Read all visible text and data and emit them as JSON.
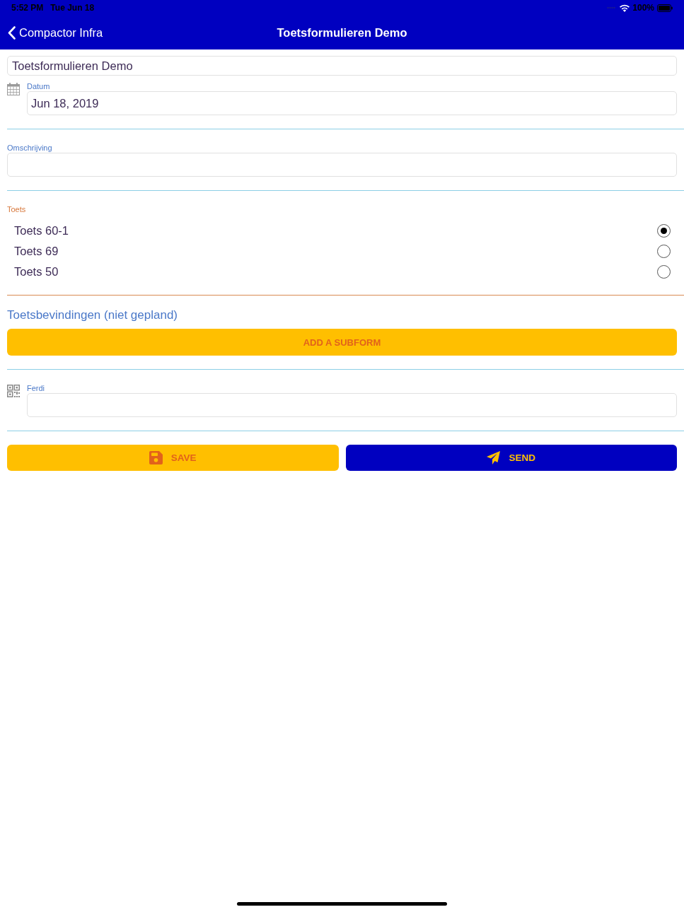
{
  "status_bar": {
    "time": "5:52 PM",
    "date": "Tue Jun 18",
    "battery": "100%"
  },
  "nav_bar": {
    "back_label": "Compactor Infra",
    "title": "Toetsformulieren Demo"
  },
  "title_field": {
    "value": "Toetsformulieren Demo"
  },
  "sections": [
    {
      "kind": "date",
      "label": "Datum",
      "value": "Jun 18, 2019"
    },
    {
      "kind": "text",
      "label": "Omschrijving"
    },
    {
      "kind": "radio",
      "label": "Toets",
      "options": [
        {
          "label": "Toets 60-1",
          "selected": true
        },
        {
          "label": "Toets 69",
          "selected": false
        },
        {
          "label": "Toets 50",
          "selected": false
        }
      ]
    },
    {
      "kind": "subform",
      "title": "Toetsbevindingen (niet gepland)",
      "button": "ADD A SUBFORM"
    },
    {
      "kind": "scan",
      "label": "Ferdi"
    }
  ],
  "actions": [
    {
      "kind": "save",
      "label": "SAVE"
    },
    {
      "kind": "send",
      "label": "SEND"
    }
  ]
}
